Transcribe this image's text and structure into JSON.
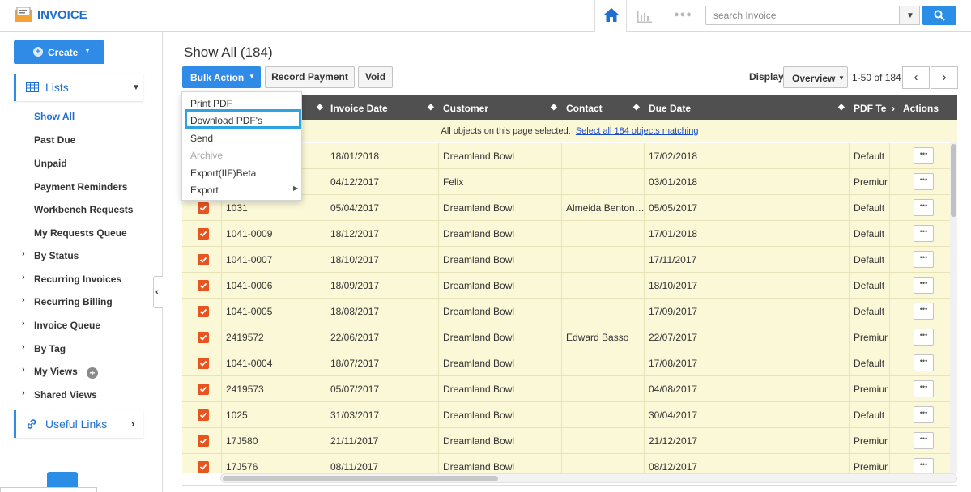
{
  "app": {
    "title": "INVOICE"
  },
  "search": {
    "placeholder": "search Invoice"
  },
  "sidebar": {
    "create_label": "Create",
    "lists_label": "Lists",
    "items": [
      {
        "label": "Show All",
        "active": true
      },
      {
        "label": "Past Due"
      },
      {
        "label": "Unpaid"
      },
      {
        "label": "Payment Reminders"
      },
      {
        "label": "Workbench Requests"
      },
      {
        "label": "My Requests Queue"
      }
    ],
    "groups": [
      {
        "label": "By Status"
      },
      {
        "label": "Recurring Invoices"
      },
      {
        "label": "Recurring Billing"
      },
      {
        "label": "Invoice Queue"
      },
      {
        "label": "By Tag"
      },
      {
        "label": "My Views"
      },
      {
        "label": "Shared Views"
      }
    ],
    "useful_links_label": "Useful Links"
  },
  "main": {
    "title": "Show All (184)",
    "bulk_action_label": "Bulk Action",
    "record_payment_label": "Record Payment",
    "void_label": "Void",
    "display_label": "Display",
    "display_value": "Overview",
    "range_text": "1-50 of 184"
  },
  "dropdown": {
    "items": [
      {
        "label": "Print PDF"
      },
      {
        "label": "Download PDF's",
        "highlighted": true
      },
      {
        "label": "Send"
      },
      {
        "label": "Archive",
        "disabled": true
      },
      {
        "label": "Export(IIF)Beta"
      },
      {
        "label": "Export",
        "submenu": true
      }
    ]
  },
  "table": {
    "headers": {
      "invoice_date": "Invoice Date",
      "customer": "Customer",
      "contact": "Contact",
      "due_date": "Due Date",
      "pdf_template": "PDF Te",
      "actions": "Actions"
    },
    "selection_text": "All objects on this page selected.",
    "selection_link": "Select all 184 objects matching",
    "rows": [
      {
        "number": "",
        "invoice_date": "18/01/2018",
        "customer": "Dreamland Bowl",
        "contact": "",
        "due_date": "17/02/2018",
        "pdf": "Default"
      },
      {
        "number": "",
        "invoice_date": "04/12/2017",
        "customer": "Felix",
        "contact": "",
        "due_date": "03/01/2018",
        "pdf": "Premium"
      },
      {
        "number": "1031",
        "invoice_date": "05/04/2017",
        "customer": "Dreamland Bowl",
        "contact": "Almeida Benton…",
        "due_date": "05/05/2017",
        "pdf": "Default"
      },
      {
        "number": "1041-0009",
        "invoice_date": "18/12/2017",
        "customer": "Dreamland Bowl",
        "contact": "",
        "due_date": "17/01/2018",
        "pdf": "Default"
      },
      {
        "number": "1041-0007",
        "invoice_date": "18/10/2017",
        "customer": "Dreamland Bowl",
        "contact": "",
        "due_date": "17/11/2017",
        "pdf": "Default"
      },
      {
        "number": "1041-0006",
        "invoice_date": "18/09/2017",
        "customer": "Dreamland Bowl",
        "contact": "",
        "due_date": "18/10/2017",
        "pdf": "Default"
      },
      {
        "number": "1041-0005",
        "invoice_date": "18/08/2017",
        "customer": "Dreamland Bowl",
        "contact": "",
        "due_date": "17/09/2017",
        "pdf": "Default"
      },
      {
        "number": "2419572",
        "invoice_date": "22/06/2017",
        "customer": "Dreamland Bowl",
        "contact": "Edward Basso",
        "due_date": "22/07/2017",
        "pdf": "Premium"
      },
      {
        "number": "1041-0004",
        "invoice_date": "18/07/2017",
        "customer": "Dreamland Bowl",
        "contact": "",
        "due_date": "17/08/2017",
        "pdf": "Default"
      },
      {
        "number": "2419573",
        "invoice_date": "05/07/2017",
        "customer": "Dreamland Bowl",
        "contact": "",
        "due_date": "04/08/2017",
        "pdf": "Premium"
      },
      {
        "number": "1025",
        "invoice_date": "31/03/2017",
        "customer": "Dreamland Bowl",
        "contact": "",
        "due_date": "30/04/2017",
        "pdf": "Default"
      },
      {
        "number": "17J580",
        "invoice_date": "21/11/2017",
        "customer": "Dreamland Bowl",
        "contact": "",
        "due_date": "21/12/2017",
        "pdf": "Premium"
      },
      {
        "number": "17J576",
        "invoice_date": "08/11/2017",
        "customer": "Dreamland Bowl",
        "contact": "",
        "due_date": "08/12/2017",
        "pdf": "Premium"
      }
    ]
  },
  "colors": {
    "accent": "#2f8be6",
    "checkbox": "#e8531e",
    "row_bg": "#fbf8d8",
    "header_bg": "#505050"
  }
}
